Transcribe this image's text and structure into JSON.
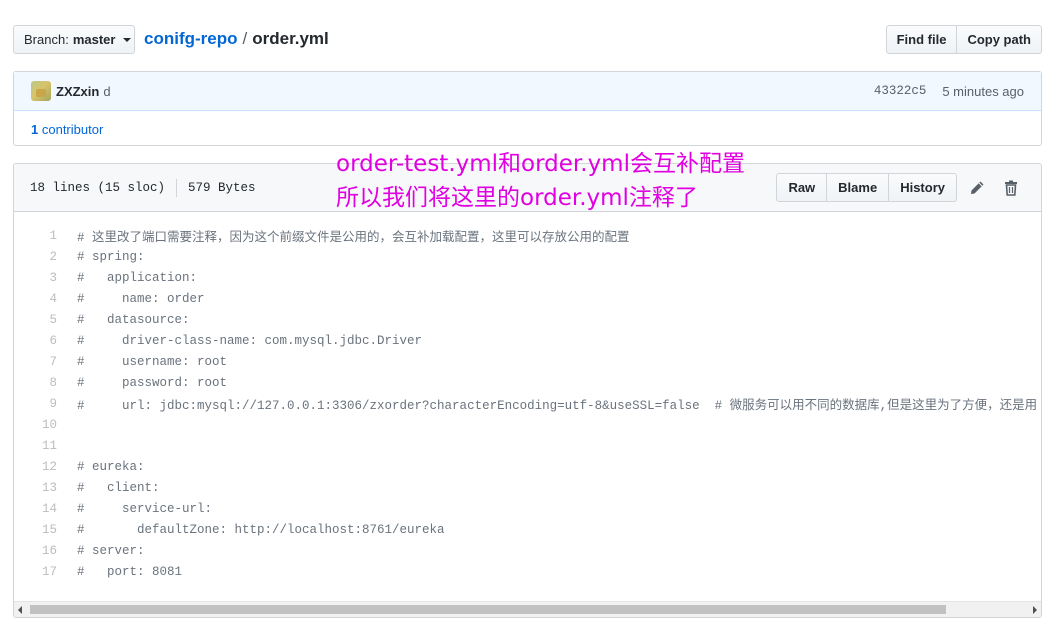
{
  "branch": {
    "label": "Branch:",
    "name": "master"
  },
  "breadcrumb": {
    "repo": "conifg-repo",
    "separator": "/",
    "file": "order.yml"
  },
  "top_actions": {
    "find_file": "Find file",
    "copy_path": "Copy path"
  },
  "commit": {
    "author": "ZXZxin",
    "message": "d",
    "sha": "43322c5",
    "time": "5 minutes ago",
    "contributors_count": "1",
    "contributors_label": "contributor"
  },
  "file": {
    "lines_info": "18 lines (15 sloc)",
    "size": "579 Bytes",
    "raw": "Raw",
    "blame": "Blame",
    "history": "History"
  },
  "code_lines": [
    {
      "n": "1",
      "text": "# 这里改了端口需要注释，因为这个前缀文件是公用的，会互补加载配置，这里可以存放公用的配置"
    },
    {
      "n": "2",
      "text": "# spring:"
    },
    {
      "n": "3",
      "text": "#   application:"
    },
    {
      "n": "4",
      "text": "#     name: order"
    },
    {
      "n": "5",
      "text": "#   datasource:"
    },
    {
      "n": "6",
      "text": "#     driver-class-name: com.mysql.jdbc.Driver"
    },
    {
      "n": "7",
      "text": "#     username: root"
    },
    {
      "n": "8",
      "text": "#     password: root"
    },
    {
      "n": "9",
      "text": "#     url: jdbc:mysql://127.0.0.1:3306/zxorder?characterEncoding=utf-8&useSSL=false  # 微服务可以用不同的数据库,但是这里为了方便，还是用"
    },
    {
      "n": "10",
      "text": ""
    },
    {
      "n": "11",
      "text": ""
    },
    {
      "n": "12",
      "text": "# eureka:"
    },
    {
      "n": "13",
      "text": "#   client:"
    },
    {
      "n": "14",
      "text": "#     service-url:"
    },
    {
      "n": "15",
      "text": "#       defaultZone: http://localhost:8761/eureka"
    },
    {
      "n": "16",
      "text": "# server:"
    },
    {
      "n": "17",
      "text": "#   port: 8081"
    }
  ],
  "annotation": {
    "line1": "order-test.yml和order.yml会互补配置",
    "line2": "所以我们将这里的order.yml注释了"
  },
  "colors": {
    "link": "#0366d6",
    "annotation": "#e100e1",
    "commit_bg": "#f1f8ff"
  },
  "icons": [
    "caret-down-icon",
    "pencil-icon",
    "trash-icon",
    "scroll-left-icon",
    "scroll-right-icon"
  ]
}
